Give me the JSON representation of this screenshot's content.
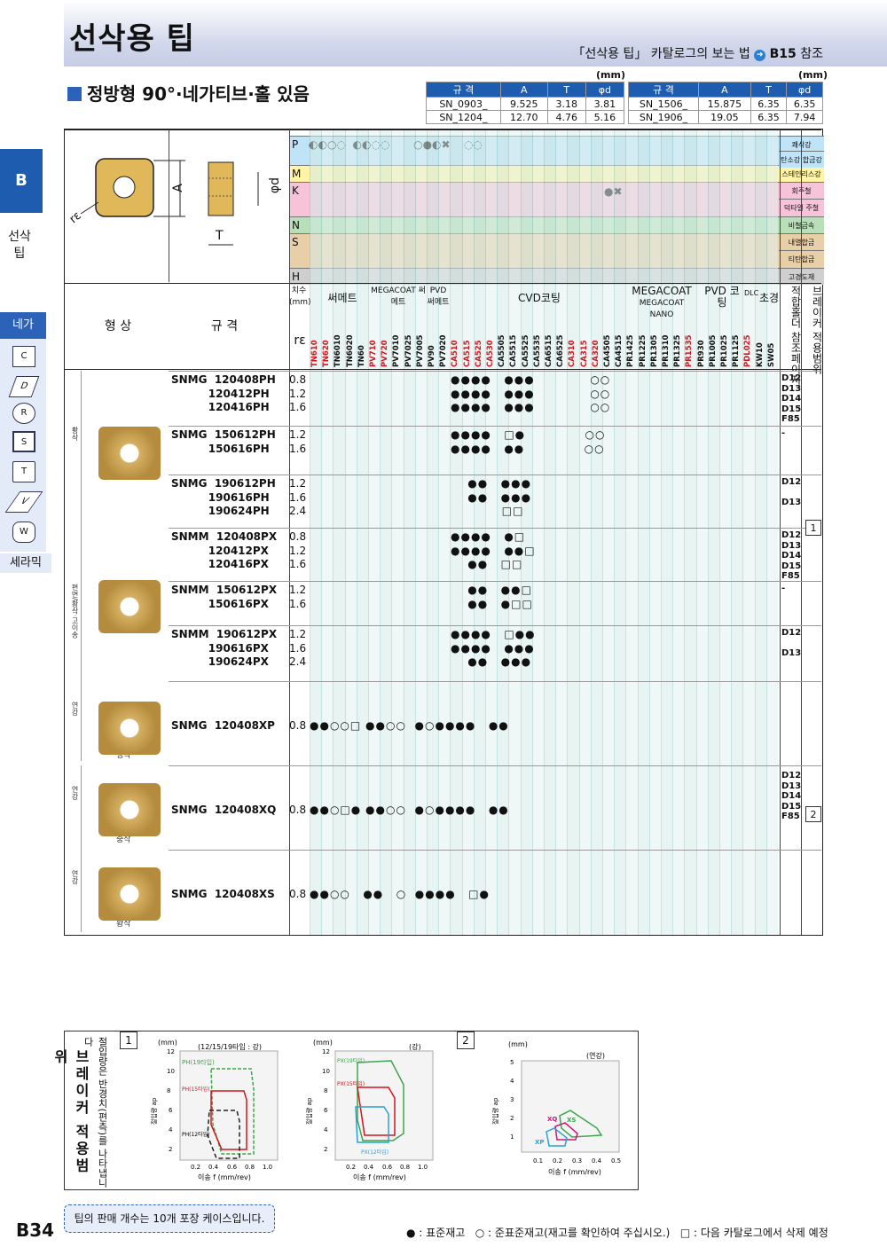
{
  "header": {
    "title": "선삭용 팁",
    "catalog_ref": "「선삭용 팁」 카탈로그의 보는 법",
    "ref_page": "B15",
    "ref_suffix": "참조"
  },
  "subtitle": "정방형 90°·네가티브·홀 있음",
  "spec_tables": {
    "unit": "(mm)",
    "columns": [
      "규 격",
      "A",
      "T",
      "φd"
    ],
    "left": [
      [
        "SN_0903_",
        "9.525",
        "3.18",
        "3.81"
      ],
      [
        "SN_1204_",
        "12.70",
        "4.76",
        "5.16"
      ]
    ],
    "right": [
      [
        "SN_1506_",
        "15.875",
        "6.35",
        "6.35"
      ],
      [
        "SN_1906_",
        "19.05",
        "6.35",
        "7.94"
      ]
    ]
  },
  "side": {
    "tab": "B",
    "category": "선삭팁",
    "nega": "네가",
    "shapes": [
      "C",
      "D",
      "R",
      "S",
      "T",
      "V",
      "W"
    ],
    "ceramic": "세라믹"
  },
  "diagram": {
    "A": "A",
    "T": "T",
    "d": "φd",
    "re": "rε"
  },
  "materials": [
    {
      "code": "P",
      "rows": [
        "탄소강·합금강"
      ],
      "title": "쾌삭강",
      "color": "#bfe3f7",
      "marks": "◐◐○◌  ◐◐◌◌       ○●◐✖    ◌◌"
    },
    {
      "code": "M",
      "title": "스테인리스강",
      "color": "#fff4a6"
    },
    {
      "code": "K",
      "title": "회주철",
      "sub": "덕타일 주철",
      "color": "#f7c3d8",
      "marks": "●✖"
    },
    {
      "code": "N",
      "title": "비철금속",
      "color": "#b9dfb9"
    },
    {
      "code": "S",
      "title": "내열합금",
      "sub": "티탄합금",
      "color": "#e9cfa8"
    },
    {
      "code": "H",
      "title": "고경도재",
      "color": "#cfcfcf"
    }
  ],
  "material_extra": [
    "탄소강·합금강",
    "덕타일 주철",
    "티탄합금"
  ],
  "columns": {
    "dims": "치수(mm)",
    "cermet": "써메트",
    "megacoat_cermet": "MEGACOAT 써메트",
    "pvd_cermet": "PVD 써메트",
    "cvd": "CVD코팅",
    "megacoat_nano_1": "MEGACOAT",
    "megacoat_nano_2": "MEGACOAT NANO",
    "pvd": "PVD 코팅",
    "dlc": "DLC",
    "carbide": "초경",
    "holder": "적합홀더 참조페이지",
    "breaker": "브레이커 적용범위",
    "shape": "형 상",
    "spec": "규 격",
    "re": "rε",
    "grades": [
      "TN610",
      "TN620",
      "TN6010",
      "TN6020",
      "TN60",
      "PV710",
      "PV720",
      "PV7010",
      "PV7025",
      "PV7005",
      "PV90",
      "PV7020",
      "CA510",
      "CA515",
      "CA525",
      "CA530",
      "CA5505",
      "CA5515",
      "CA5525",
      "CA5535",
      "CA6515",
      "CA6525",
      "CA310",
      "CA315",
      "CA320",
      "CA4505",
      "CA4515",
      "PR1425",
      "PR1225",
      "PR1305",
      "PR1310",
      "PR1325",
      "PR1535",
      "PR930",
      "PR1005",
      "PR1025",
      "PR1125",
      "PDL025",
      "KW10",
      "SW05"
    ]
  },
  "rows": [
    {
      "cat": "황삭",
      "specs": "SNMG  120408PH\n          120412PH\n          120416PH",
      "re": "0.8\n1.2\n1.6",
      "marks": "●●●●   ●●●             ○○\n●●●●   ●●●             ○○\n●●●●   ●●●             ○○",
      "range": "D12\nD13\nD14\nD15\nF85"
    },
    {
      "specs": "SNMG  150612PH\n          150616PH",
      "re": "1.2\n1.6",
      "marks": "●●●●   □●              ○○\n●●●●   ●●              ○○",
      "range": "-"
    },
    {
      "specs": "SNMG  190612PH\n          190616PH\n          190624PH",
      "re": "1.2\n1.6\n2.4",
      "marks": "    ●●   ●●●\n    ●●   ●●●\n            □□",
      "range": "D12\n\nD13"
    },
    {
      "cat": "편면/황삭·고이송",
      "specs": "SNMM  120408PX\n          120412PX\n          120416PX",
      "re": "0.8\n1.2\n1.6",
      "marks": "●●●●   ●□\n●●●●   ●●□\n    ●●   □□",
      "range": "D12\nD13\nD14\nD15\nF85",
      "box": "1"
    },
    {
      "specs": "SNMM  150612PX\n          150616PX",
      "re": "1.2\n1.6",
      "marks": "    ●●   ●●□\n    ●●   ●□□",
      "range": "-"
    },
    {
      "specs": "SNMM  190612PX\n          190616PX\n          190624PX",
      "re": "1.2\n1.6\n2.4",
      "marks": "●●●●   □●●\n●●●●   ●●●\n    ●●   ●●●",
      "range": "D12\n\nD13"
    },
    {
      "cat": "연강",
      "sub": "정삭",
      "specs": "SNMG  120408XP",
      "re": "0.8",
      "cermet": "●●○○□ ●●○○  ●○●●●●   ●●"
    },
    {
      "cat": "연강",
      "sub": "중삭",
      "specs": "SNMG  120408XQ",
      "re": "0.8",
      "cermet": "●●○□● ●●○○  ●○●●●●   ●●",
      "range": "D12\nD13\nD14\nD15\nF85",
      "box": "2"
    },
    {
      "cat": "연강",
      "sub": "황삭",
      "specs": "SNMG  120408XS",
      "re": "0.8",
      "cermet": "●●○○   ●●   ○  ●●●●   □●"
    }
  ],
  "breaker_charts": {
    "title": "브레이커 적용범위",
    "desc": "절입량은 반경치(편측)를 나타냅니다",
    "c1": {
      "num": "1",
      "unit": "(mm)",
      "subtitle": "(12/15/19타입 : 강)",
      "ylabel": "절입량 ap",
      "xlabel": "이송 f (mm/rev)",
      "yticks": [
        "12",
        "10",
        "8",
        "6",
        "4",
        "2"
      ],
      "xticks": [
        "0.2",
        "0.4",
        "0.6",
        "0.8",
        "1.0"
      ],
      "labels": [
        "PH(19타입)",
        "PH(15타입)",
        "PH(12타입)"
      ]
    },
    "c2": {
      "unit": "(mm)",
      "subtitle": "(강)",
      "ylabel": "절입량 ap",
      "xlabel": "이송 f (mm/rev)",
      "yticks": [
        "12",
        "10",
        "8",
        "6",
        "4",
        "2"
      ],
      "xticks": [
        "0.2",
        "0.4",
        "0.6",
        "0.8",
        "1.0"
      ],
      "labels": [
        "PX(19타입)",
        "PX(15타입)",
        "PX(12타입)"
      ]
    },
    "c3": {
      "num": "2",
      "unit": "(mm)",
      "subtitle": "(연강)",
      "ylabel": "절입량 ap",
      "xlabel": "이송 f (mm/rev)",
      "yticks": [
        "5",
        "4",
        "3",
        "2",
        "1"
      ],
      "xticks": [
        "0.1",
        "0.2",
        "0.3",
        "0.4",
        "0.5"
      ],
      "labels": [
        "XQ",
        "XS",
        "XP"
      ]
    }
  },
  "footer": {
    "page": "B34",
    "note": "팁의 판매 개수는 10개 포장 케이스입니다.",
    "legend_std": "● : 표준재고",
    "legend_semi": "○ : 준표준재고(재고를 확인하여 주십시오.)",
    "legend_del": "□ : 다음 카탈로그에서 삭제 예정"
  }
}
